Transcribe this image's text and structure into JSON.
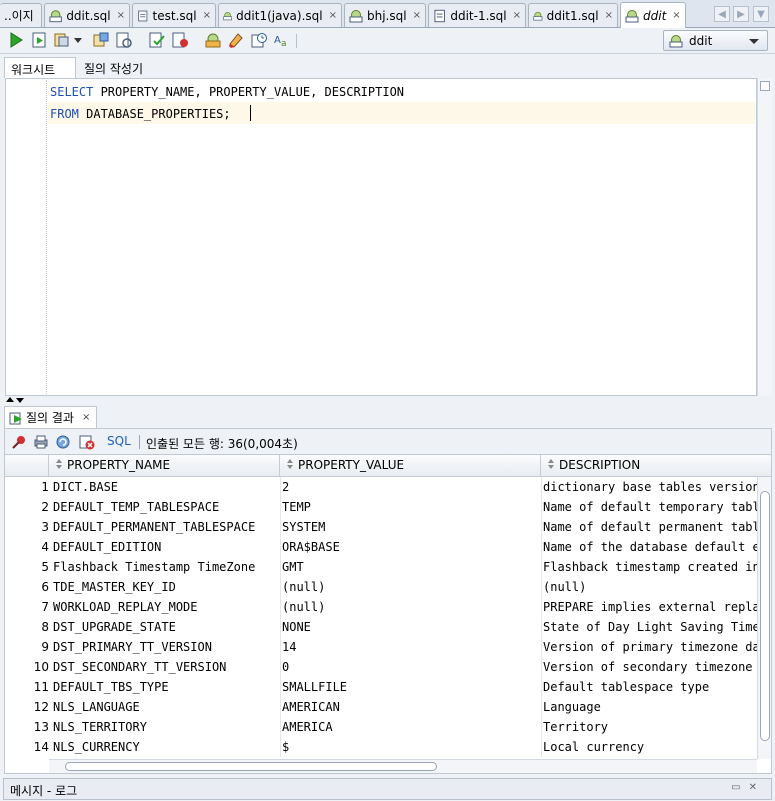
{
  "tabs": [
    {
      "label": "..이지",
      "icon": "none",
      "active": false
    },
    {
      "label": "ddit.sql",
      "icon": "sql-file-icon",
      "active": false
    },
    {
      "label": "test.sql",
      "icon": "sql-file-icon",
      "active": false
    },
    {
      "label": "ddit1(java).sql",
      "icon": "sql-file-icon",
      "active": false
    },
    {
      "label": "bhj.sql",
      "icon": "sql-file-icon",
      "active": false
    },
    {
      "label": "ddit-1.sql",
      "icon": "sql-file-icon",
      "active": false
    },
    {
      "label": "ddit1.sql",
      "icon": "sql-file-icon",
      "active": false
    },
    {
      "label": "ddit",
      "icon": "sql-worksheet-icon",
      "active": true
    }
  ],
  "tab_close": "×",
  "toolbar": {
    "connection": "ddit",
    "icons": [
      "run-statement-icon",
      "run-script-icon",
      "explain-plan-icon",
      "autotrace-icon",
      "sql-tuning-icon",
      "commit-icon",
      "rollback-icon",
      "unshared-sql-icon",
      "clear-icon",
      "history-icon",
      "format-icon"
    ]
  },
  "subtabs": {
    "worksheet": "워크시트",
    "query_builder": "질의 작성기"
  },
  "editor": {
    "line1_kw": "SELECT",
    "line1_rest": " PROPERTY_NAME, PROPERTY_VALUE, DESCRIPTION",
    "line2_kw": "FROM",
    "line2_rest": " DATABASE_PROPERTIES;"
  },
  "result": {
    "tab_label": "질의 결과",
    "tab_close": "×",
    "sql_label": "SQL",
    "rows_info": "인출된 모든 행: 36(0,004초)",
    "columns": [
      "PROPERTY_NAME",
      "PROPERTY_VALUE",
      "DESCRIPTION"
    ],
    "rows": [
      {
        "n": "1",
        "name": "DICT.BASE",
        "value": "2",
        "desc": "dictionary base tables version #"
      },
      {
        "n": "2",
        "name": "DEFAULT_TEMP_TABLESPACE",
        "value": "TEMP",
        "desc": "Name of default temporary tablespace"
      },
      {
        "n": "3",
        "name": "DEFAULT_PERMANENT_TABLESPACE",
        "value": "SYSTEM",
        "desc": "Name of default permanent tablespace"
      },
      {
        "n": "4",
        "name": "DEFAULT_EDITION",
        "value": "ORA$BASE",
        "desc": "Name of the database default edition"
      },
      {
        "n": "5",
        "name": "Flashback Timestamp TimeZone",
        "value": "GMT",
        "desc": "Flashback timestamp created in GMT"
      },
      {
        "n": "6",
        "name": "TDE_MASTER_KEY_ID",
        "value": "(null)",
        "desc": "(null)"
      },
      {
        "n": "7",
        "name": "WORKLOAD_REPLAY_MODE",
        "value": "(null)",
        "desc": "PREPARE implies external replay"
      },
      {
        "n": "8",
        "name": "DST_UPGRADE_STATE",
        "value": "NONE",
        "desc": "State of Day Light Saving Time Upgrade"
      },
      {
        "n": "9",
        "name": "DST_PRIMARY_TT_VERSION",
        "value": "14",
        "desc": "Version of primary timezone data file"
      },
      {
        "n": "10",
        "name": "DST_SECONDARY_TT_VERSION",
        "value": "0",
        "desc": "Version of secondary timezone data file"
      },
      {
        "n": "11",
        "name": "DEFAULT_TBS_TYPE",
        "value": "SMALLFILE",
        "desc": "Default tablespace type"
      },
      {
        "n": "12",
        "name": "NLS_LANGUAGE",
        "value": "AMERICAN",
        "desc": "Language"
      },
      {
        "n": "13",
        "name": "NLS_TERRITORY",
        "value": "AMERICA",
        "desc": "Territory"
      },
      {
        "n": "14",
        "name": "NLS_CURRENCY",
        "value": "$",
        "desc": "Local currency"
      }
    ]
  },
  "messages": {
    "title": "메시지 - 로그"
  }
}
